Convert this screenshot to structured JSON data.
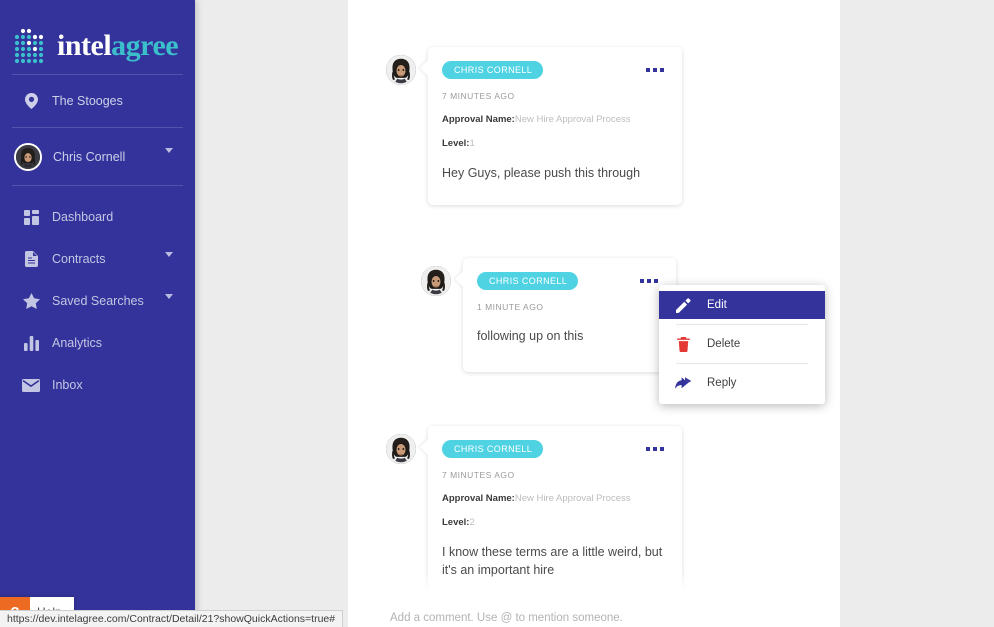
{
  "sidebar": {
    "logo": {
      "word1": "intel",
      "word2": "agree",
      "icon": "logo-dots-icon"
    },
    "org": {
      "label": "The Stooges",
      "icon": "location-pin-icon"
    },
    "user": {
      "name": "Chris Cornell",
      "icon": "user-avatar",
      "caret": "chevron-down-icon"
    },
    "items": [
      {
        "label": "Dashboard",
        "icon": "dashboard-grid-icon",
        "has_caret": false
      },
      {
        "label": "Contracts",
        "icon": "document-icon",
        "has_caret": true
      },
      {
        "label": "Saved Searches",
        "icon": "star-icon",
        "has_caret": true
      },
      {
        "label": "Analytics",
        "icon": "bar-chart-icon",
        "has_caret": false
      },
      {
        "label": "Inbox",
        "icon": "envelope-icon",
        "has_caret": false
      }
    ],
    "help": {
      "label": "Help",
      "badge": "?"
    }
  },
  "comments": [
    {
      "author": "CHRIS CORNELL",
      "time": "7 MINUTES AGO",
      "approval_label": "Approval Name:",
      "approval_value": "New Hire Approval Process",
      "level_label": "Level:",
      "level_value": "1",
      "body": "Hey Guys, please push this through",
      "menu_icon": "ellipsis-icon"
    },
    {
      "author": "CHRIS CORNELL",
      "time": "1 MINUTE AGO",
      "body": "following up on this",
      "menu_icon": "ellipsis-icon"
    },
    {
      "author": "CHRIS CORNELL",
      "time": "7 MINUTES AGO",
      "approval_label": "Approval Name:",
      "approval_value": "New Hire Approval Process",
      "level_label": "Level:",
      "level_value": "2",
      "body": "I know these terms are a little weird, but it's an important hire",
      "menu_icon": "ellipsis-icon"
    }
  ],
  "context_menu": {
    "items": [
      {
        "label": "Edit",
        "icon": "pencil-icon",
        "active": true
      },
      {
        "label": "Delete",
        "icon": "trash-icon",
        "active": false
      },
      {
        "label": "Reply",
        "icon": "reply-arrow-icon",
        "active": false
      }
    ]
  },
  "comment_input": {
    "placeholder": "Add a comment. Use @ to mention someone."
  },
  "status_bar": {
    "url": "https://dev.intelagree.com/Contract/Detail/21?showQuickActions=true#"
  },
  "colors": {
    "sidebar": "#33339b",
    "accent_teal": "#3bbfcb",
    "chip": "#4fd3e3",
    "help_orange": "#ec6a21",
    "delete_red": "#e53935",
    "page_bg": "#ececec"
  }
}
